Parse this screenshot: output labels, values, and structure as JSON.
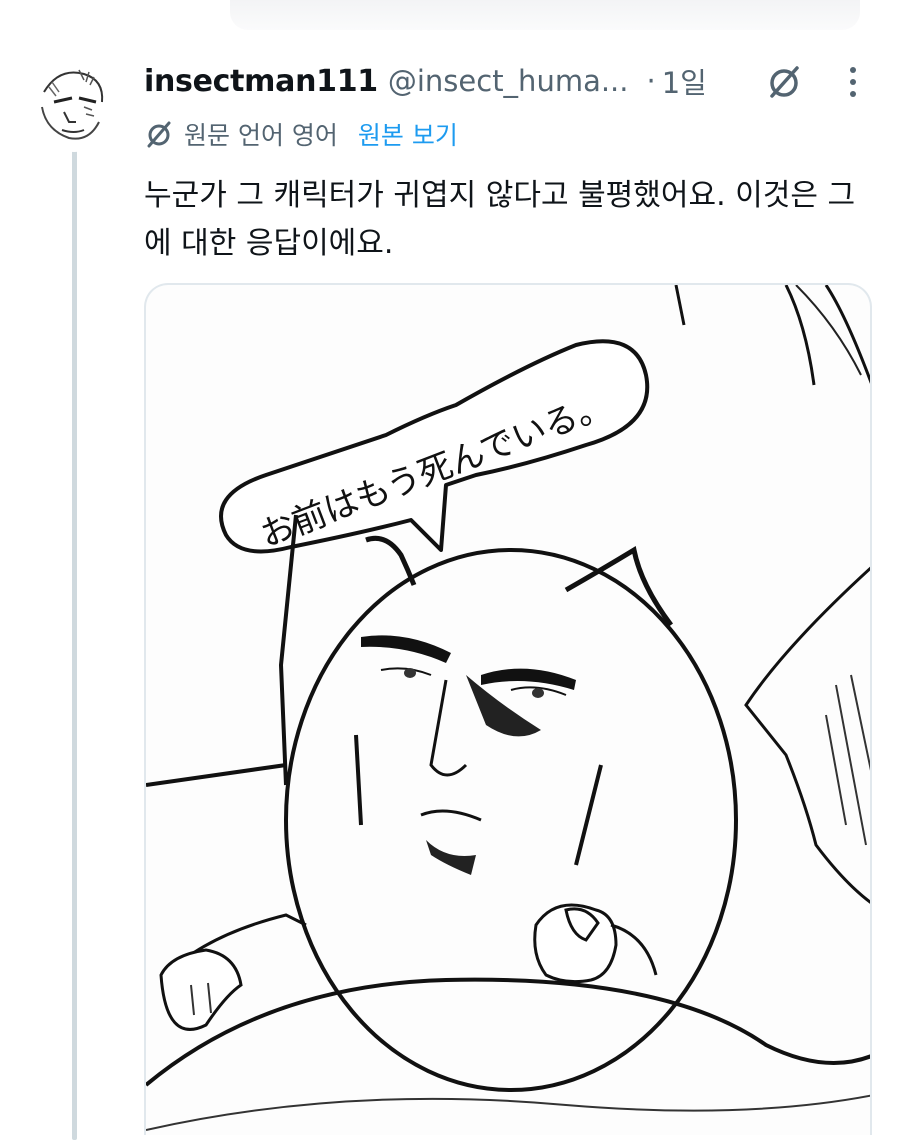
{
  "tweet": {
    "display_name": "insectman111",
    "handle": "@insect_huma...",
    "separator": "·",
    "time": "1일",
    "translation": {
      "label": "원문 언어 영어",
      "show_original": "원본 보기"
    },
    "text": "누군가 그 캐릭터가 귀엽지 않다고 불평했어요. 이것은 그에 대한 응답이에요.",
    "image": {
      "speech_bubble_text": "お前はもう死んでいる。"
    }
  },
  "icons": {
    "grok": "slashed-circle-icon",
    "more": "vertical-dots-icon",
    "translate": "slashed-circle-icon"
  },
  "colors": {
    "text": "#0f1419",
    "secondary": "#536471",
    "link": "#1d9bf0",
    "thread_line": "#cfd9de"
  }
}
